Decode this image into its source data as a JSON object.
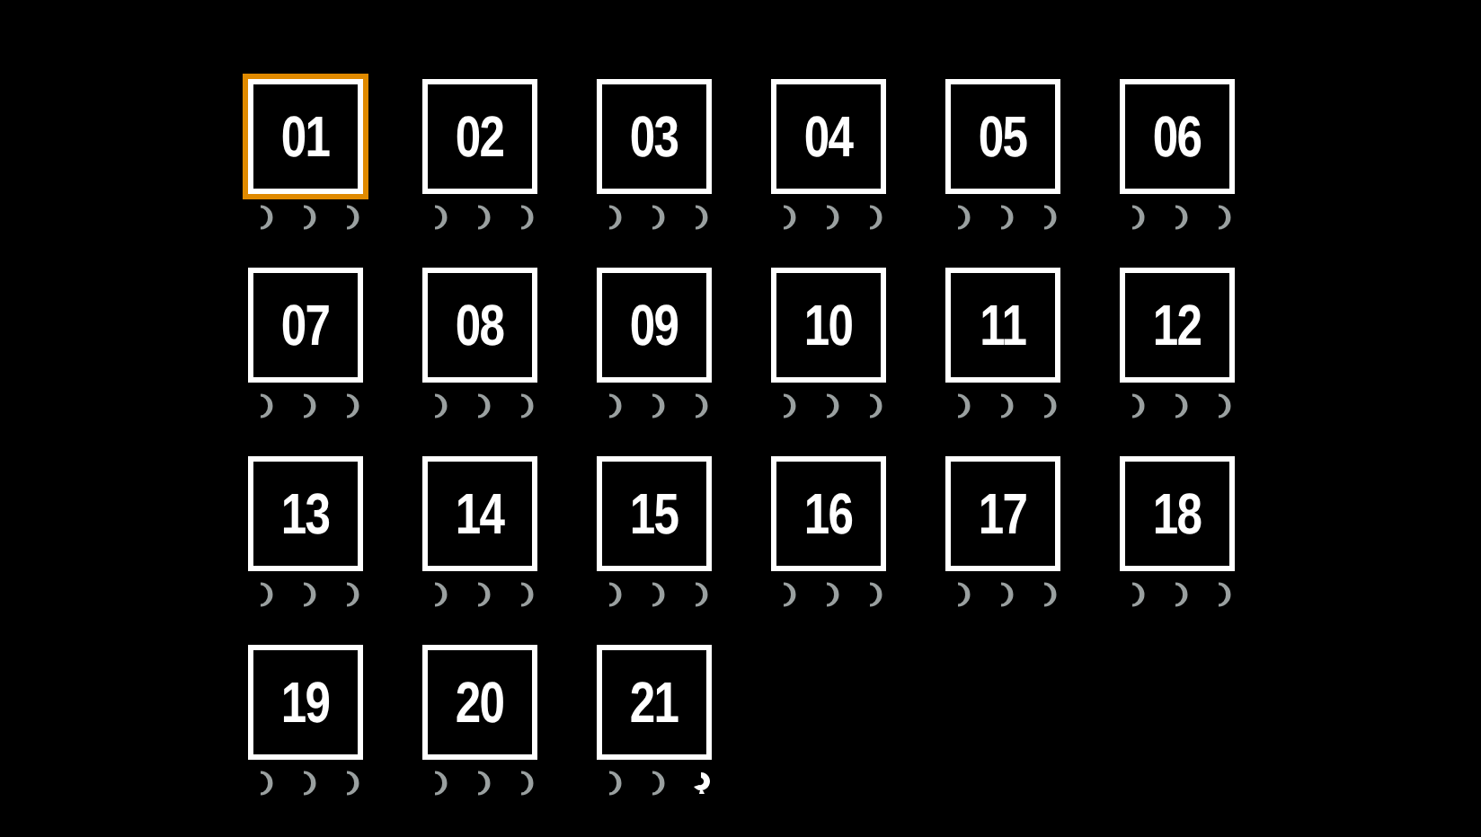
{
  "levels": [
    {
      "label": "01",
      "selected": true,
      "moons": [
        {
          "collected": false
        },
        {
          "collected": false
        },
        {
          "collected": false
        }
      ]
    },
    {
      "label": "02",
      "selected": false,
      "moons": [
        {
          "collected": false
        },
        {
          "collected": false
        },
        {
          "collected": false
        }
      ]
    },
    {
      "label": "03",
      "selected": false,
      "moons": [
        {
          "collected": false
        },
        {
          "collected": false
        },
        {
          "collected": false
        }
      ]
    },
    {
      "label": "04",
      "selected": false,
      "moons": [
        {
          "collected": false
        },
        {
          "collected": false
        },
        {
          "collected": false
        }
      ]
    },
    {
      "label": "05",
      "selected": false,
      "moons": [
        {
          "collected": false
        },
        {
          "collected": false
        },
        {
          "collected": false
        }
      ]
    },
    {
      "label": "06",
      "selected": false,
      "moons": [
        {
          "collected": false
        },
        {
          "collected": false
        },
        {
          "collected": false
        }
      ]
    },
    {
      "label": "07",
      "selected": false,
      "moons": [
        {
          "collected": false
        },
        {
          "collected": false
        },
        {
          "collected": false
        }
      ]
    },
    {
      "label": "08",
      "selected": false,
      "moons": [
        {
          "collected": false
        },
        {
          "collected": false
        },
        {
          "collected": false
        }
      ]
    },
    {
      "label": "09",
      "selected": false,
      "moons": [
        {
          "collected": false
        },
        {
          "collected": false
        },
        {
          "collected": false
        }
      ]
    },
    {
      "label": "10",
      "selected": false,
      "moons": [
        {
          "collected": false
        },
        {
          "collected": false
        },
        {
          "collected": false
        }
      ]
    },
    {
      "label": "11",
      "selected": false,
      "moons": [
        {
          "collected": false
        },
        {
          "collected": false
        },
        {
          "collected": false
        }
      ]
    },
    {
      "label": "12",
      "selected": false,
      "moons": [
        {
          "collected": false
        },
        {
          "collected": false
        },
        {
          "collected": false
        }
      ]
    },
    {
      "label": "13",
      "selected": false,
      "moons": [
        {
          "collected": false
        },
        {
          "collected": false
        },
        {
          "collected": false
        }
      ]
    },
    {
      "label": "14",
      "selected": false,
      "moons": [
        {
          "collected": false
        },
        {
          "collected": false
        },
        {
          "collected": false
        }
      ]
    },
    {
      "label": "15",
      "selected": false,
      "moons": [
        {
          "collected": false
        },
        {
          "collected": false
        },
        {
          "collected": false
        }
      ]
    },
    {
      "label": "16",
      "selected": false,
      "moons": [
        {
          "collected": false
        },
        {
          "collected": false
        },
        {
          "collected": false
        }
      ]
    },
    {
      "label": "17",
      "selected": false,
      "moons": [
        {
          "collected": false
        },
        {
          "collected": false
        },
        {
          "collected": false
        }
      ]
    },
    {
      "label": "18",
      "selected": false,
      "moons": [
        {
          "collected": false
        },
        {
          "collected": false
        },
        {
          "collected": false
        }
      ]
    },
    {
      "label": "19",
      "selected": false,
      "moons": [
        {
          "collected": false
        },
        {
          "collected": false
        },
        {
          "collected": false
        }
      ]
    },
    {
      "label": "20",
      "selected": false,
      "moons": [
        {
          "collected": false
        },
        {
          "collected": false
        },
        {
          "collected": false
        }
      ]
    },
    {
      "label": "21",
      "selected": false,
      "moons": [
        {
          "collected": false
        },
        {
          "collected": false
        },
        {
          "collected": true
        }
      ]
    }
  ]
}
